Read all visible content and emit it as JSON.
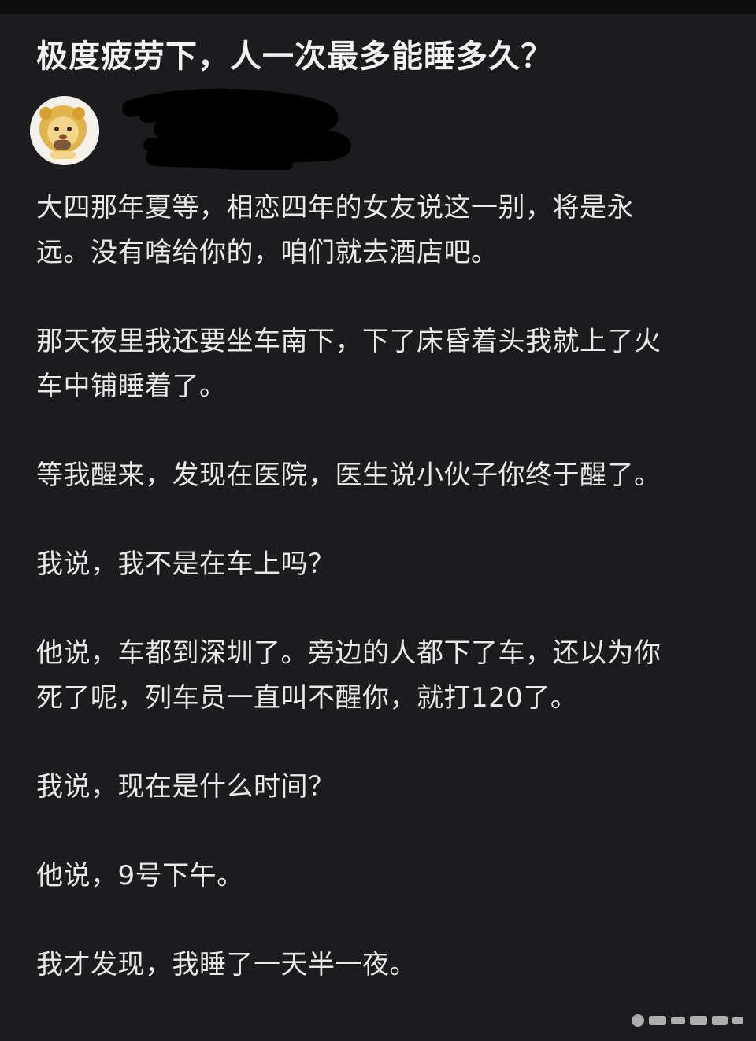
{
  "question": {
    "title": "极度疲劳下，人一次最多能睡多久？"
  },
  "author": {
    "name": "",
    "subtitle": ""
  },
  "answer": {
    "paragraphs": [
      "大四那年夏等，相恋四年的女友说这一别，将是永远。没有啥给你的，咱们就去酒店吧。",
      "那天夜里我还要坐车南下，下了床昏着头我就上了火车中铺睡着了。",
      "等我醒来，发现在医院，医生说小伙子你终于醒了。",
      "我说，我不是在车上吗？",
      "他说，车都到深圳了。旁边的人都下了车，还以为你死了呢，列车员一直叫不醒你，就打120了。",
      "我说，现在是什么时间？",
      "他说，9号下午。",
      "我才发现，我睡了一天半一夜。"
    ]
  },
  "icons": {
    "avatar": "lion-cartoon-avatar",
    "redaction": "black-scribble-redaction",
    "watermark": "platform-watermark"
  },
  "colors": {
    "background": "#1c1c1e",
    "text": "#e8e8e8",
    "title": "#f2f2f2",
    "avatar_mane": "#e0b44a"
  }
}
